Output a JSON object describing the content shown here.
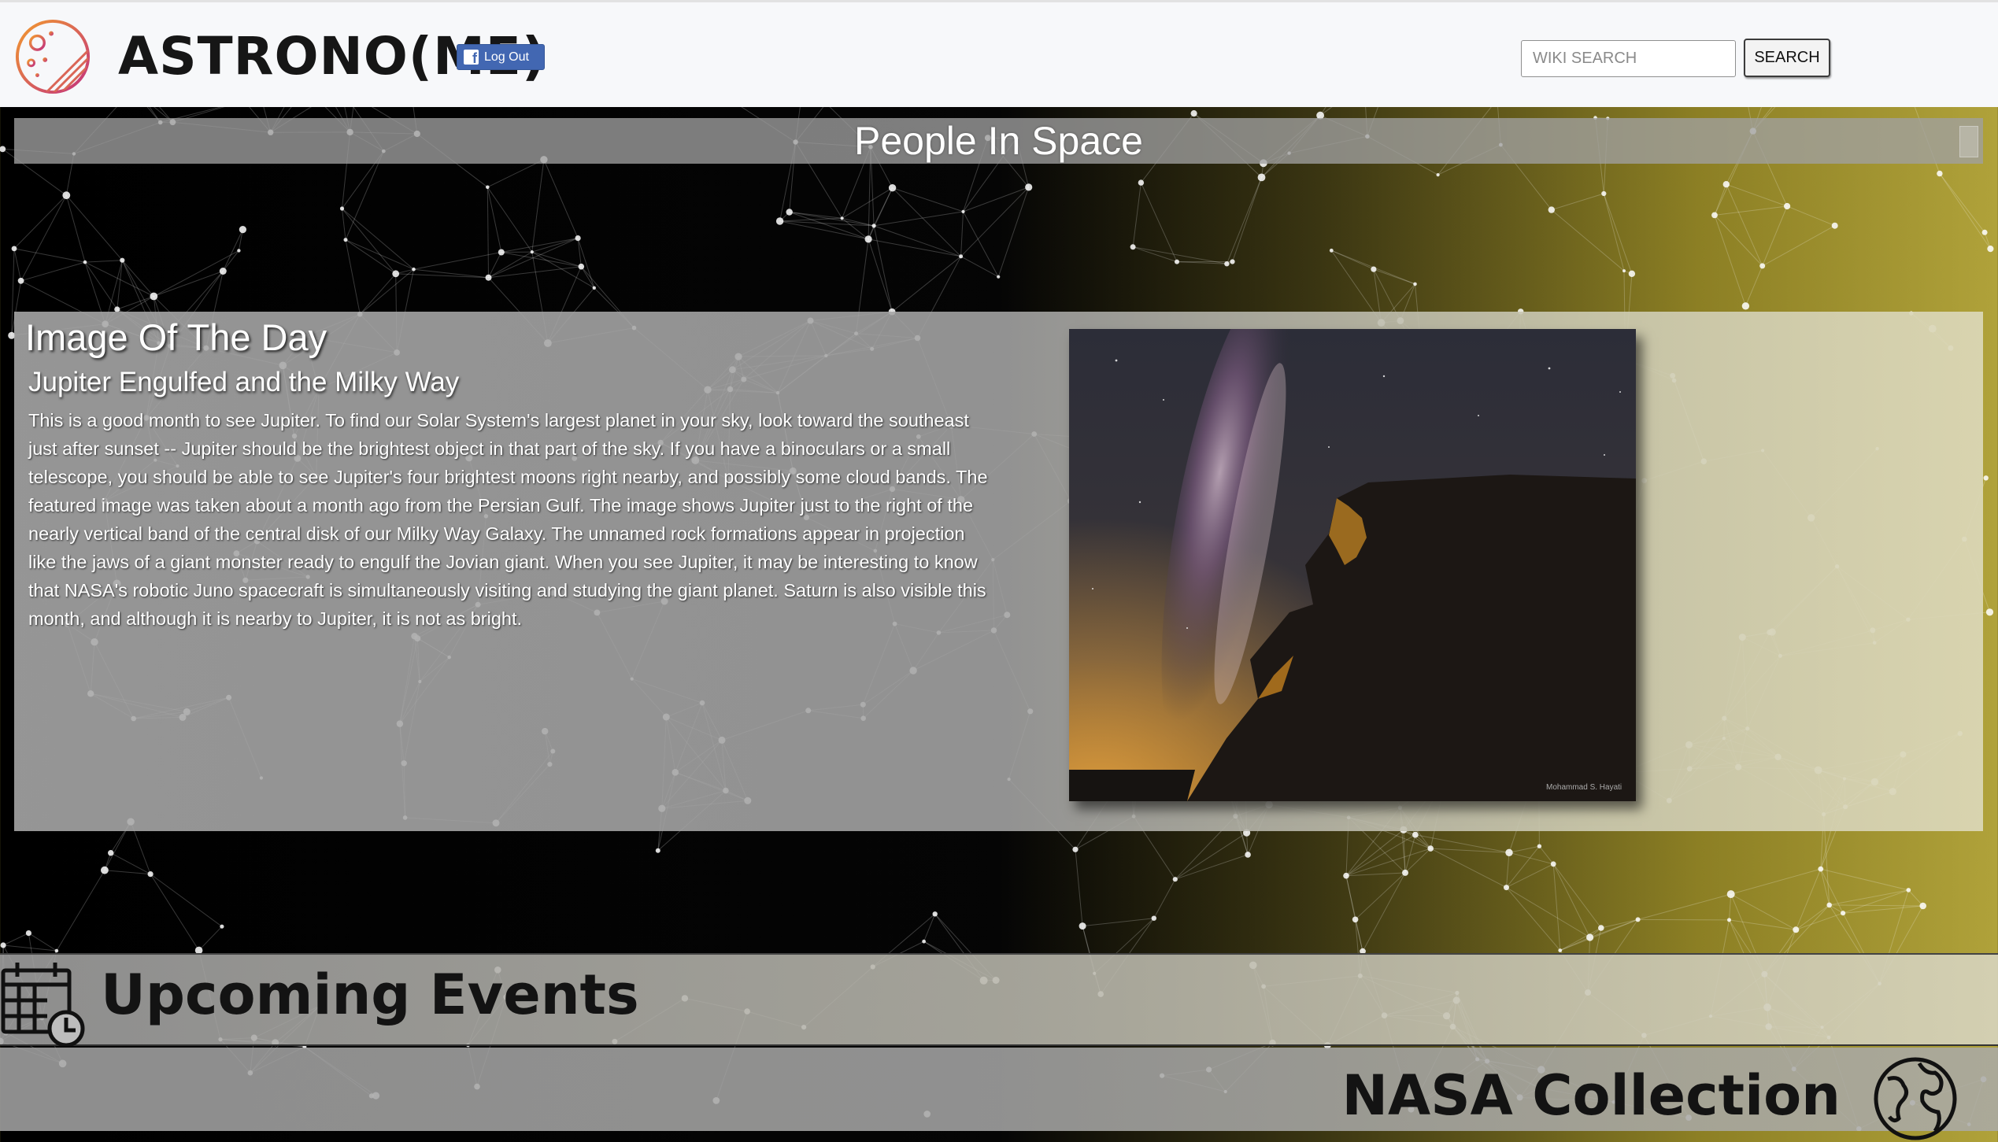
{
  "header": {
    "brand": "ASTRONO(ME)",
    "logout_label": "Log Out",
    "search_placeholder": "WIKI SEARCH",
    "search_button": "SEARCH"
  },
  "people_in_space": {
    "title": "People In Space"
  },
  "image_of_the_day": {
    "heading": "Image Of The Day",
    "title": "Jupiter Engulfed and the Milky Way",
    "description": "This is a good month to see Jupiter. To find our Solar System's largest planet in your sky, look toward the southeast just after sunset -- Jupiter should be the brightest object in that part of the sky. If you have a binoculars or a small telescope, you should be able to see Jupiter's four brightest moons right nearby, and possibly some cloud bands. The featured image was taken about a month ago from the Persian Gulf. The image shows Jupiter just to the right of the nearly vertical band of the central disk of our Milky Way Galaxy. The unnamed rock formations appear in projection like the jaws of a giant monster ready to engulf the Jovian giant. When you see Jupiter, it may be interesting to know that NASA's robotic Juno spacecraft is simultaneously visiting and studying the giant planet. Saturn is also visible this month, and although it is nearby to Jupiter, it is not as bright.",
    "image_credit": "Mohammad S. Hayati"
  },
  "sections": {
    "events_title": "Upcoming Events",
    "nasa_title": "NASA Collection"
  },
  "colors": {
    "facebook_blue": "#4267b2",
    "header_bg": "#f7f8fa",
    "logo_orange": "#e8862a",
    "logo_magenta": "#c33a7e"
  },
  "icons": {
    "logo": "planet-icon",
    "facebook": "facebook-icon",
    "events": "calendar-clock-icon",
    "nasa": "globe-icon"
  }
}
